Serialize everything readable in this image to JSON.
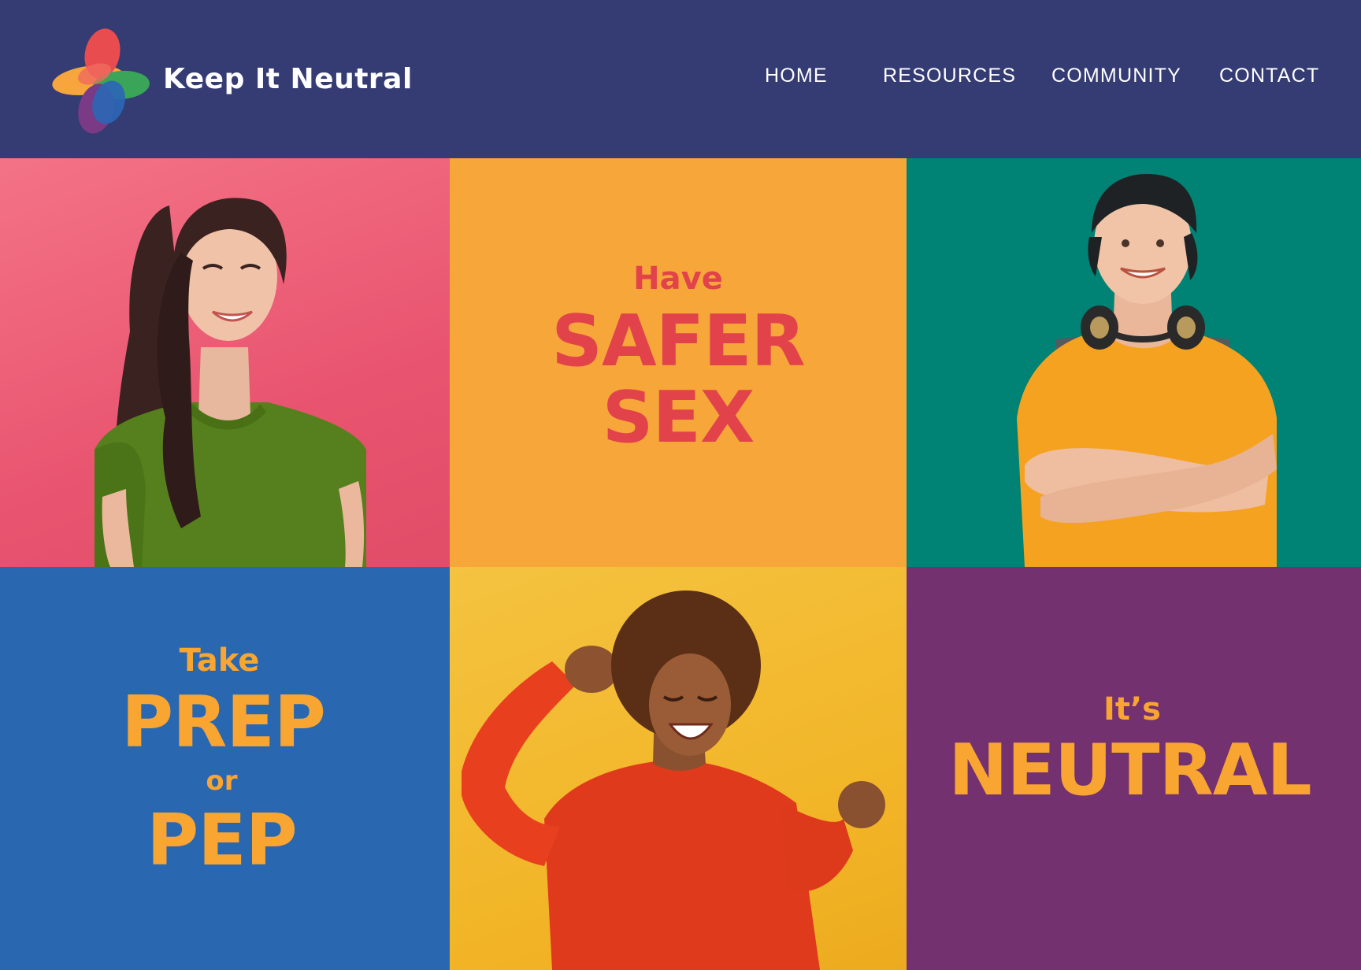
{
  "brand": {
    "name": "Keep It Neutral",
    "logo_icon": "four-petal-cross-logo-icon"
  },
  "nav": {
    "items": [
      {
        "label": "HOME"
      },
      {
        "label": "RESOURCES"
      },
      {
        "label": "COMMUNITY"
      },
      {
        "label": "CONTACT"
      }
    ]
  },
  "tiles": {
    "safer_sex": {
      "line1": "Have",
      "line2": "SAFER",
      "line3": "SEX"
    },
    "prep": {
      "line1": "Take",
      "line2": "PREP",
      "line3": "or",
      "line4": "PEP"
    },
    "neutral": {
      "line1": "It’s",
      "line2": "NEUTRAL"
    }
  },
  "colors": {
    "header": "#353c73",
    "pink": "#e95570",
    "orange": "#f7a73a",
    "teal": "#008274",
    "blue": "#2a67b1",
    "yellow": "#f2b426",
    "purple": "#733170",
    "slogan_red": "#e2434b",
    "slogan_orange": "#f8a532"
  }
}
